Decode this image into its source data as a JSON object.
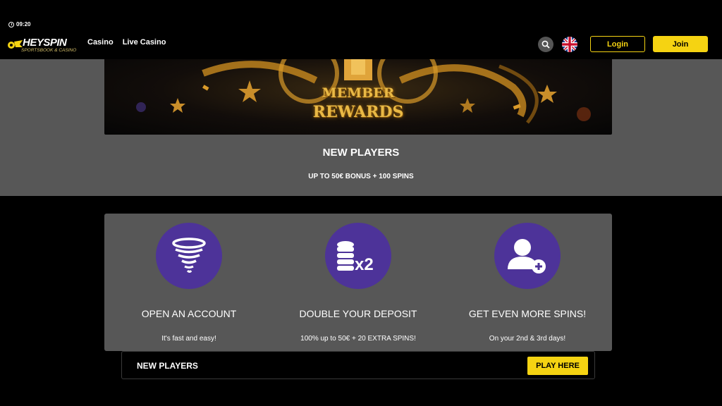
{
  "status": {
    "time": "09:20"
  },
  "brand": {
    "name": "HEYSPIN",
    "tagline": "SPORTSBOOK & CASINO",
    "accent": "#f5d312"
  },
  "nav": {
    "items": [
      {
        "label": "Casino"
      },
      {
        "label": "Live Casino"
      }
    ]
  },
  "header_actions": {
    "search_icon": "search-icon",
    "language_icon": "uk-flag-icon",
    "login_label": "Login",
    "join_label": "Join"
  },
  "banner": {
    "line1": "MEMBER",
    "line2": "REWARDS"
  },
  "promo": {
    "heading": "NEW PLAYERS",
    "subheading": "UP TO 50€ BONUS + 100 SPINS"
  },
  "steps": [
    {
      "icon": "tornado-icon",
      "title": "OPEN AN ACCOUNT",
      "description": "It's fast and easy!"
    },
    {
      "icon": "coins-x2-icon",
      "icon_text": "x2",
      "title": "DOUBLE YOUR DEPOSIT",
      "description": "100% up to 50€ + 20 EXTRA SPINS!"
    },
    {
      "icon": "add-user-icon",
      "title": "GET EVEN MORE SPINS!",
      "description": "On your 2nd & 3rd days!"
    }
  ],
  "cta": {
    "label": "NEW PLAYERS",
    "button_label": "PLAY HERE"
  },
  "colors": {
    "panel": "#575757",
    "icon_circle": "#4d3399",
    "background": "#000000"
  }
}
